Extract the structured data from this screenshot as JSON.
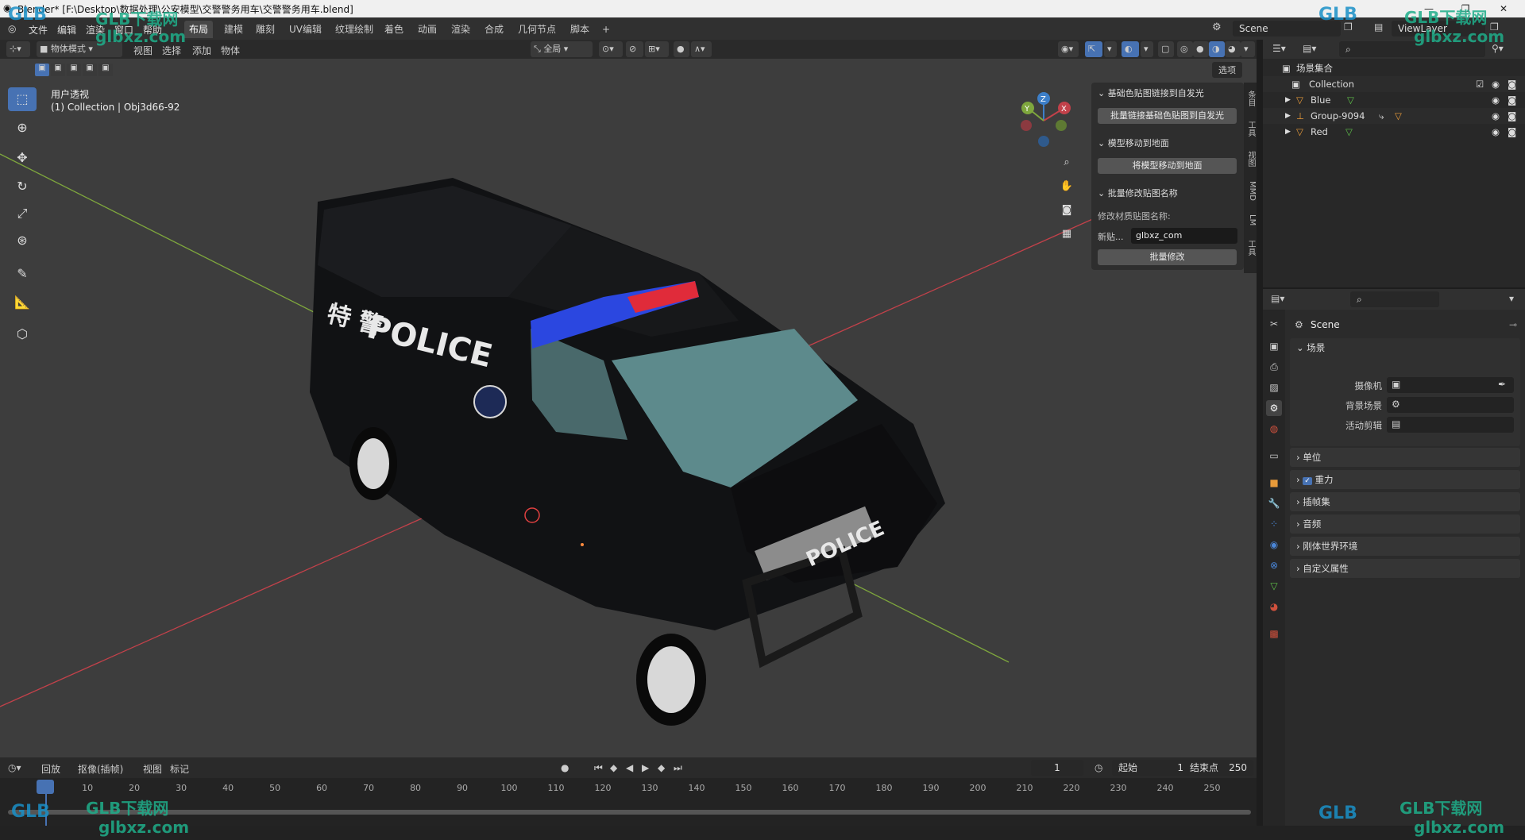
{
  "window": {
    "title": "Blender* [F:\\Desktop\\数据处理\\公安模型\\交警警务用车\\交警警务用车.blend]",
    "controls": [
      "—",
      "❐",
      "✕"
    ]
  },
  "menu": {
    "items": [
      "文件",
      "编辑",
      "渲染",
      "窗口",
      "帮助"
    ],
    "workspaces": [
      "布局",
      "建模",
      "雕刻",
      "UV编辑",
      "纹理绘制",
      "着色",
      "动画",
      "渲染",
      "合成",
      "几何节点",
      "脚本"
    ],
    "add_tab": "+",
    "scene_label": "Scene",
    "viewlayer_label": "ViewLayer"
  },
  "viewport_header": {
    "mode": "物体模式",
    "menus": [
      "视图",
      "选择",
      "添加",
      "物体"
    ],
    "transform_orientation": "全局",
    "options": "选项"
  },
  "viewport": {
    "view_name": "用户透视",
    "collection_info": "(1) Collection | Obj3d66-92",
    "gizmo_axes": [
      "X",
      "Y",
      "Z"
    ]
  },
  "npanel": {
    "section1_title": "基础色贴图链接到自发光",
    "section1_button": "批量链接基础色贴图到自发光",
    "section2_title": "模型移动到地面",
    "section2_button": "将模型移动到地面",
    "section3_title": "批量修改贴图名称",
    "section3_label": "修改材质贴图名称:",
    "new_label": "新贴...",
    "new_value": "glbxz_com",
    "section3_button": "批量修改",
    "tabs": [
      "条目",
      "工具",
      "视图",
      "MMD",
      "LM",
      "工具"
    ]
  },
  "outliner": {
    "root": "场景集合",
    "collection": "Collection",
    "items": [
      {
        "name": "Blue"
      },
      {
        "name": "Group-9094"
      },
      {
        "name": "Red"
      }
    ]
  },
  "properties": {
    "scene_name": "Scene",
    "panel_title": "场景",
    "fields": [
      "摄像机",
      "背景场景",
      "活动剪辑"
    ],
    "sections": [
      "单位",
      "重力",
      "插帧集",
      "音频",
      "刚体世界环境",
      "自定义属性"
    ]
  },
  "timeline": {
    "menus": [
      "回放",
      "抠像(插帧)",
      "视图",
      "标记"
    ],
    "current_frame": "1",
    "start_label": "起始",
    "start_value": "1",
    "end_label": "结束点",
    "end_value": "250",
    "ticks": [
      "1",
      "10",
      "20",
      "30",
      "40",
      "50",
      "60",
      "70",
      "80",
      "90",
      "100",
      "110",
      "120",
      "130",
      "140",
      "150",
      "160",
      "170",
      "180",
      "190",
      "200",
      "210",
      "220",
      "230",
      "240",
      "250"
    ]
  },
  "car_text": {
    "side_chinese": "特 警",
    "side_police": "POLICE",
    "hood_police": "POLICE"
  },
  "watermarks": {
    "brand": "GLB下载网",
    "logo": "GLB",
    "url": "glbxz.com"
  },
  "colors": {
    "accent": "#4772b3",
    "x_axis": "#c2414a",
    "y_axis": "#7ea63d",
    "z_axis": "#3d7fc9"
  }
}
